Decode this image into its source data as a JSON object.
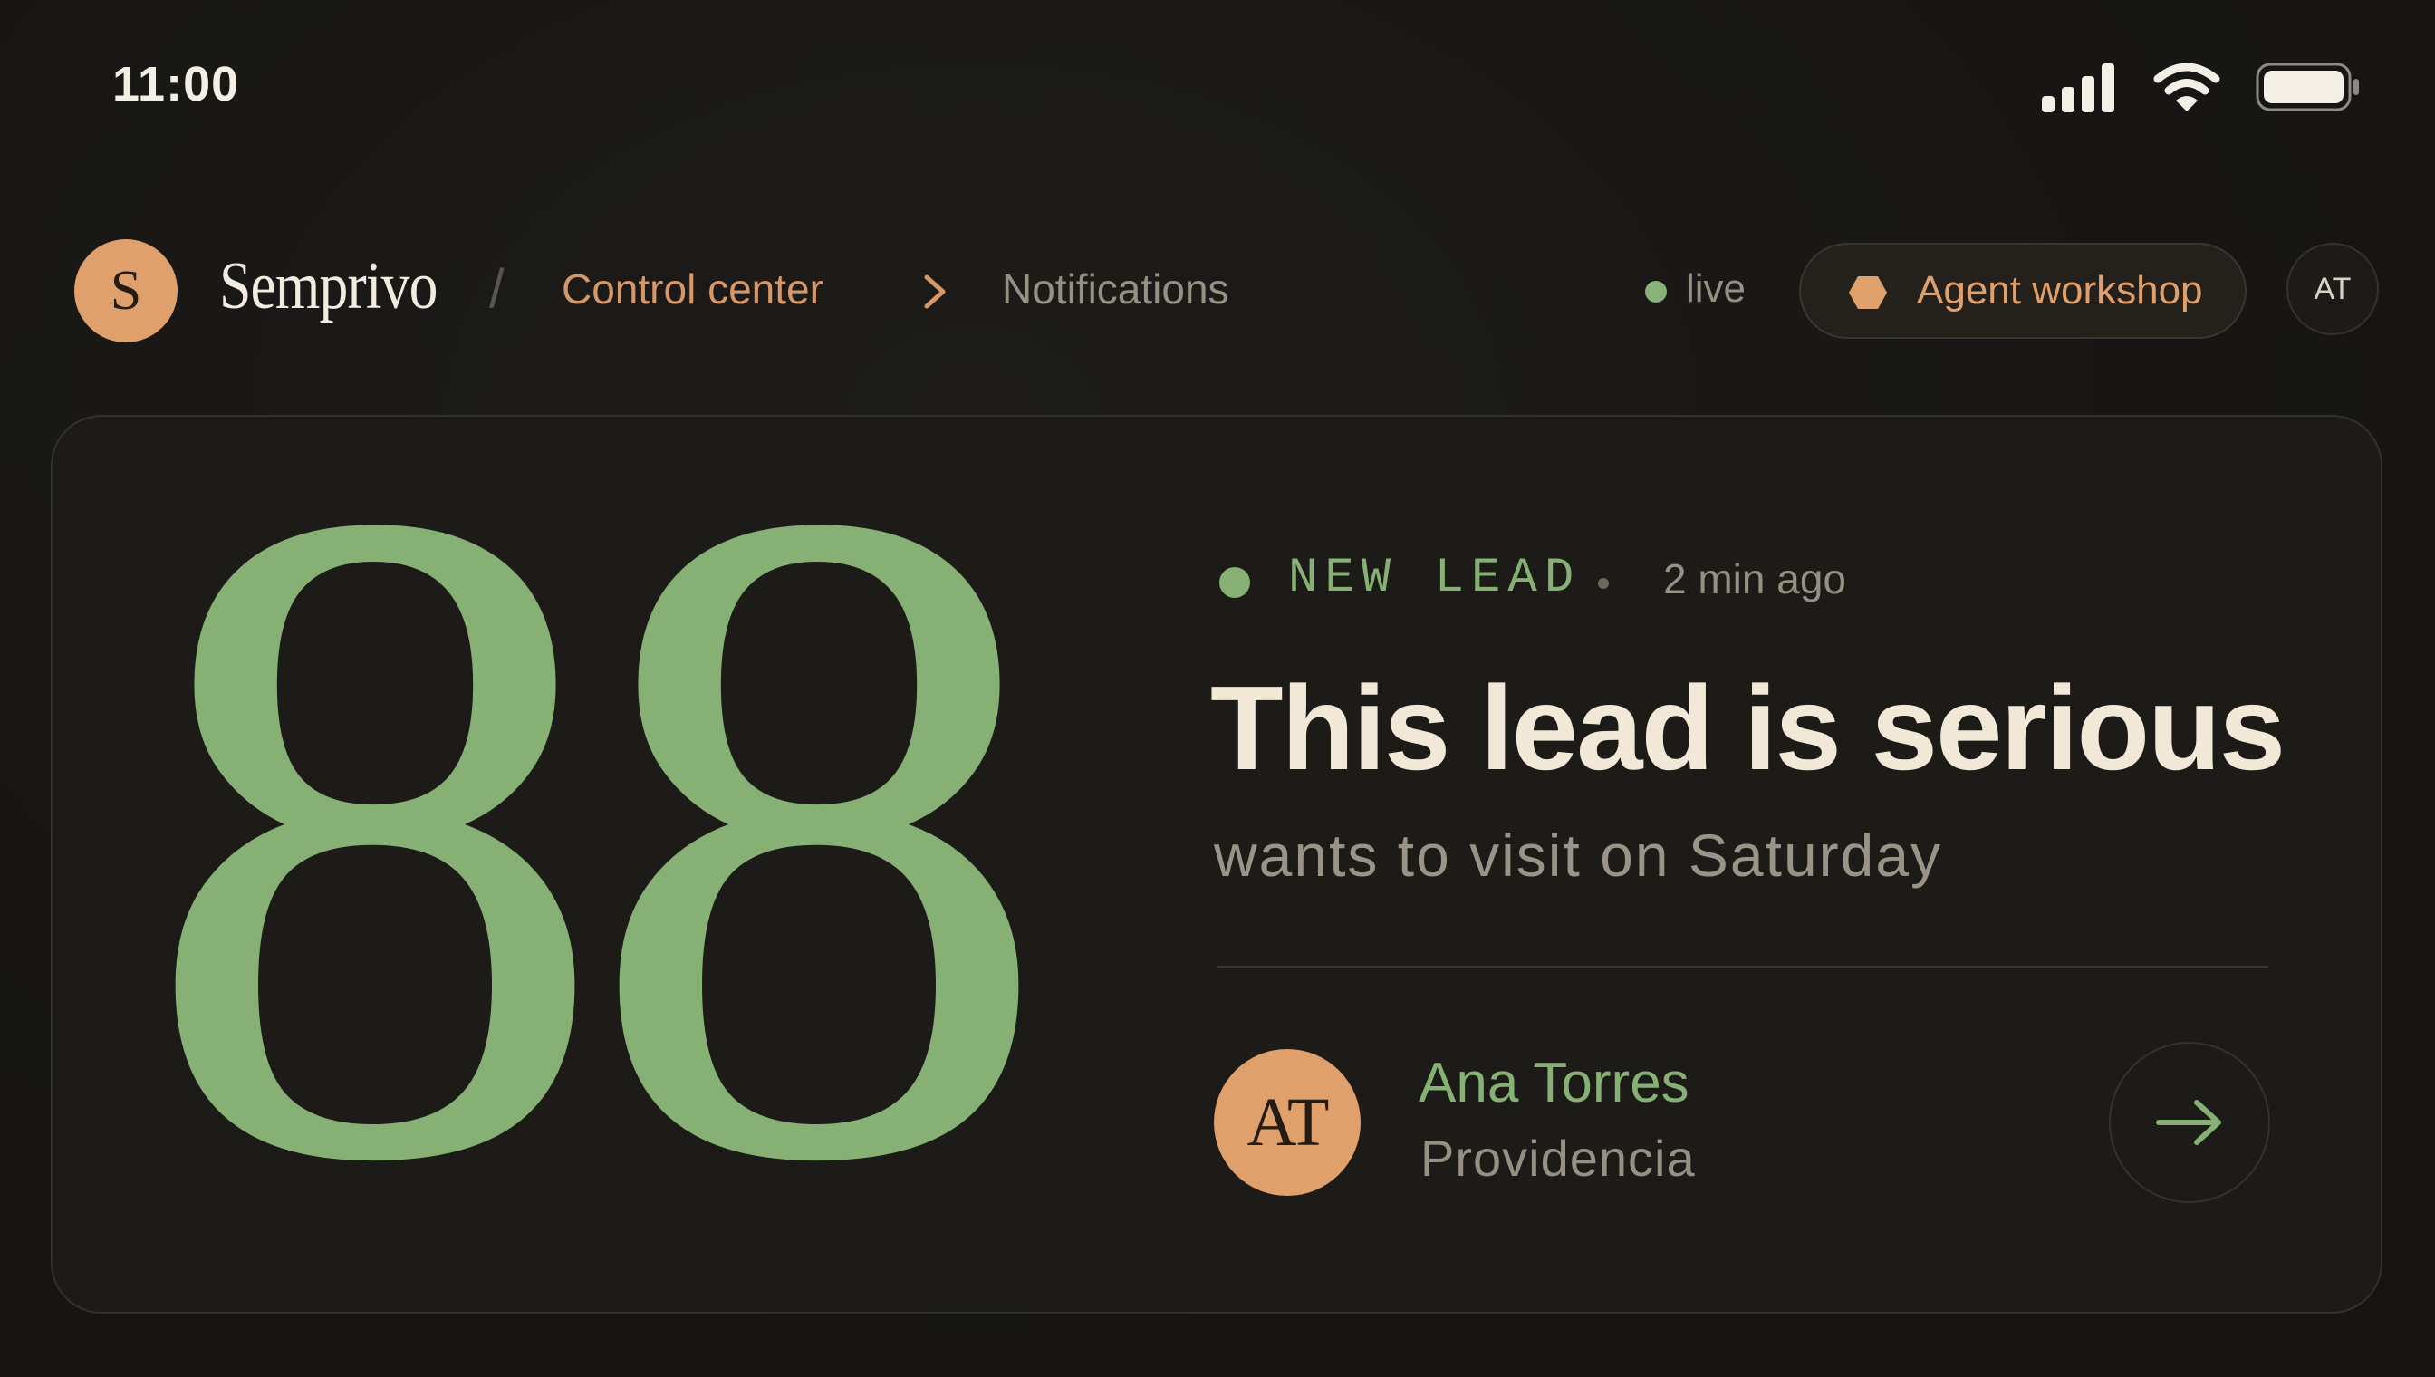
{
  "status_bar": {
    "time": "11:00"
  },
  "header": {
    "brand": {
      "logo_letter": "S",
      "name": "Semprivo"
    },
    "breadcrumb": {
      "separator": "/",
      "items": [
        "Control center",
        "Notifications"
      ]
    },
    "live_label": "live",
    "workshop_button": "Agent workshop",
    "user_initials": "AT"
  },
  "lead_card": {
    "score": "88",
    "tag": "NEW LEAD",
    "time_ago": "2 min ago",
    "title": "This lead is serious",
    "subtitle": "wants to visit on Saturday",
    "contact": {
      "initials": "AT",
      "name": "Ana Torres",
      "location": "Providencia"
    }
  },
  "colors": {
    "background": "#181714",
    "accent_orange": "#e0a06c",
    "accent_green": "#86b074",
    "muted_text": "#968f84",
    "title_text": "#f2e8d8"
  },
  "icons": {
    "signal": "cellular-signal-icon",
    "wifi": "wifi-icon",
    "battery": "battery-icon",
    "chevron": "chevron-right-icon",
    "workshop": "hexagon-icon",
    "open": "arrow-right-icon"
  }
}
